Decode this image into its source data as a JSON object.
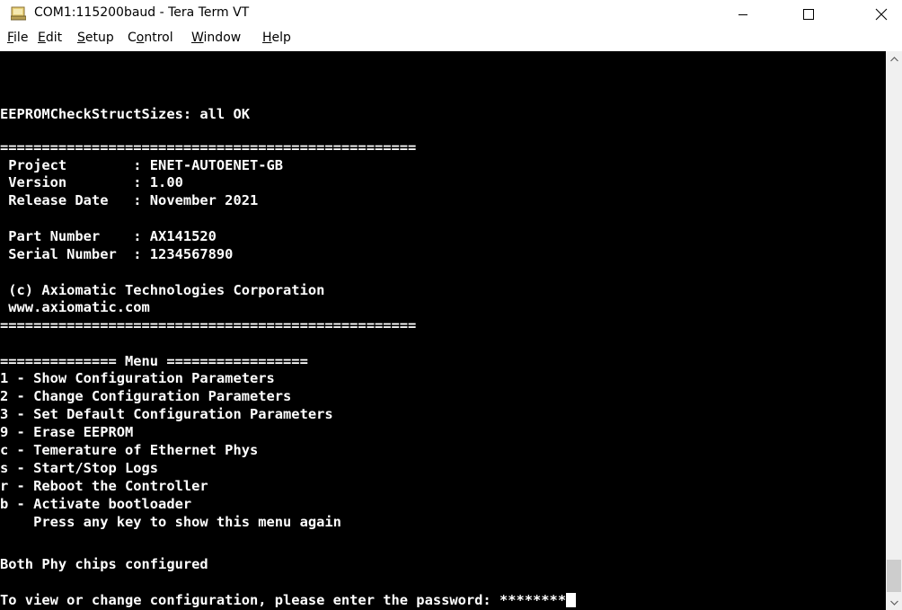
{
  "window": {
    "title": "COM1:115200baud - Tera Term VT",
    "icon": "tera-term-icon",
    "controls": [
      "minimize-icon",
      "maximize-icon",
      "close-icon"
    ]
  },
  "menubar": {
    "items": [
      {
        "accel": "F",
        "rest": "ile"
      },
      {
        "accel": "E",
        "rest": "dit"
      },
      {
        "accel": "S",
        "rest": "etup"
      },
      {
        "pre": "C",
        "accel": "o",
        "rest": "ntrol"
      },
      {
        "accel": "W",
        "rest": "indow"
      },
      {
        "accel": "H",
        "rest": "elp"
      }
    ]
  },
  "terminal": {
    "lines": [
      "EEPROMCheckStructSizes: all OK",
      "==================================================",
      " Project        : ENET-AUTOENET-GB",
      " Version        : 1.00",
      " Release Date   : November 2021",
      " Part Number    : AX141520",
      " Serial Number  : 1234567890",
      " (c) Axiomatic Technologies Corporation",
      " www.axiomatic.com",
      "==================================================",
      "============== Menu =================",
      "1 - Show Configuration Parameters",
      "2 - Change Configuration Parameters",
      "3 - Set Default Configuration Parameters",
      "9 - Erase EEPROM",
      "c - Temerature of Ethernet Phys",
      "s - Start/Stop Logs",
      "r - Reboot the Controller",
      "b - Activate bootloader",
      "    Press any key to show this menu again",
      "Both Phy chips configured",
      "To view or change configuration, please enter the password: ********"
    ]
  },
  "scrollbar": {
    "up_icon": "scroll-up-arrow-icon",
    "down_icon": "scroll-down-arrow-icon"
  }
}
